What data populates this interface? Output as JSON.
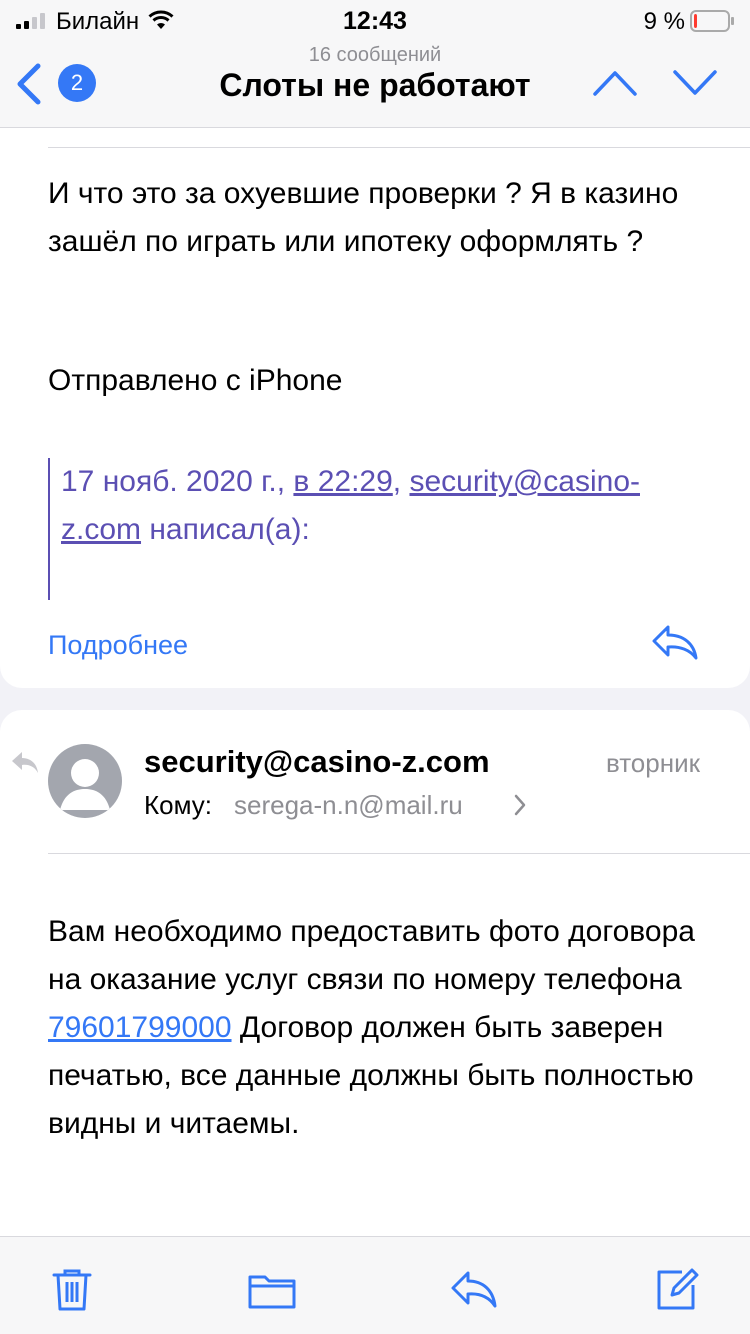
{
  "status_bar": {
    "carrier": "Билайн",
    "time": "12:43",
    "battery": "9 %",
    "battery_level": 0.09,
    "battery_color": "#ff3b30"
  },
  "nav": {
    "back_badge": "2",
    "message_count": "16 сообщений",
    "title": "Слоты не работают",
    "accent": "#3478f6"
  },
  "message1": {
    "body": "И что это за охуевшие проверки ? Я в казино зашёл по играть или ипотеку оформлять ?",
    "signature": "Отправлено с iPhone",
    "quote": {
      "date": "17 нояб. 2020 г.,",
      "time_link": "в 22:29",
      "comma": ",",
      "email_link": "security@casino-z.com",
      "wrote": "написал(а):"
    },
    "more_link": "Подробнее"
  },
  "message2": {
    "sender": "security@casino-z.com",
    "date": "вторник",
    "to_label": "Кому:",
    "to_address": "serega-n.n@mail.ru",
    "body_before_phone": "Вам необходимо предоставить фото договора на оказание услуг связи по номеру телефона",
    "phone": "79601799000",
    "body_after_phone": "Договор должен быть заверен печатью, все данные должны быть полностью видны и читаемы."
  },
  "toolbar": {
    "icons": [
      "trash-icon",
      "folder-icon",
      "reply-icon",
      "compose-icon"
    ]
  }
}
